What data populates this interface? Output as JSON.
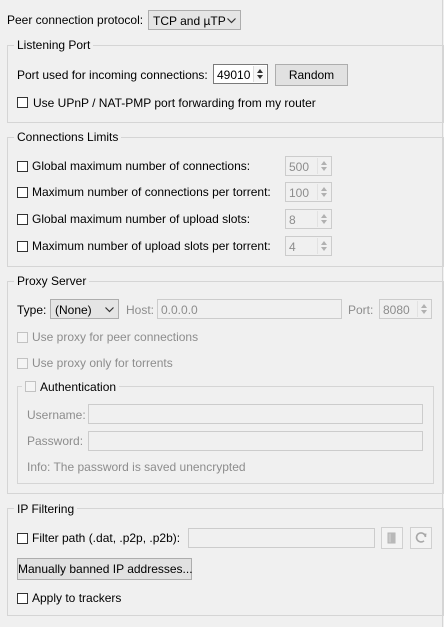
{
  "connection": {
    "protocol_label": "Peer connection protocol:",
    "protocol_value": "TCP and µTP"
  },
  "listening_port": {
    "title": "Listening Port",
    "port_label": "Port used for incoming connections:",
    "port_value": "49010",
    "random_button": "Random",
    "upnp_label": "Use UPnP / NAT-PMP port forwarding from my router",
    "upnp_checked": false
  },
  "connection_limits": {
    "title": "Connections Limits",
    "items": [
      {
        "label": "Global maximum number of connections:",
        "value": "500",
        "checked": false
      },
      {
        "label": "Maximum number of connections per torrent:",
        "value": "100",
        "checked": false
      },
      {
        "label": "Global maximum number of upload slots:",
        "value": "8",
        "checked": false
      },
      {
        "label": "Maximum number of upload slots per torrent:",
        "value": "4",
        "checked": false
      }
    ]
  },
  "proxy": {
    "title": "Proxy Server",
    "type_label": "Type:",
    "type_value": "(None)",
    "host_label": "Host:",
    "host_value": "0.0.0.0",
    "port_label": "Port:",
    "port_value": "8080",
    "peer_label": "Use proxy for peer connections",
    "torrents_label": "Use proxy only for torrents",
    "auth": {
      "title": "Authentication",
      "username_label": "Username:",
      "username_value": "",
      "password_label": "Password:",
      "password_value": "",
      "info": "Info: The password is saved unencrypted"
    }
  },
  "ip_filtering": {
    "title": "IP Filtering",
    "filter_label": "Filter path (.dat, .p2p, .p2b):",
    "filter_value": "",
    "banned_button": "Manually banned IP addresses...",
    "trackers_label": "Apply to trackers"
  },
  "icons": {
    "dropdown": "chevron-down-icon",
    "browse": "folder-icon",
    "reload": "refresh-icon"
  }
}
